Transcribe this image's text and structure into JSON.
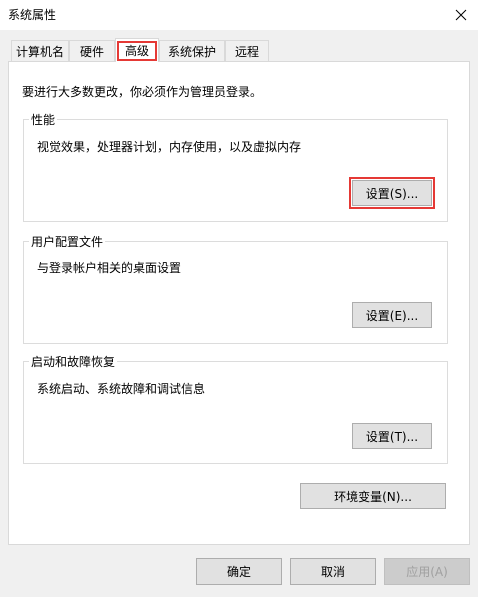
{
  "window": {
    "title": "系统属性"
  },
  "tabs": [
    {
      "label": "计算机名",
      "active": false
    },
    {
      "label": "硬件",
      "active": false
    },
    {
      "label": "高级",
      "active": true
    },
    {
      "label": "系统保护",
      "active": false
    },
    {
      "label": "远程",
      "active": false
    }
  ],
  "advanced": {
    "admin_note": "要进行大多数更改，你必须作为管理员登录。",
    "performance": {
      "title": "性能",
      "description": "视觉效果，处理器计划，内存使用，以及虚拟内存",
      "button": "设置(S)..."
    },
    "user_profiles": {
      "title": "用户配置文件",
      "description": "与登录帐户相关的桌面设置",
      "button": "设置(E)..."
    },
    "startup_recovery": {
      "title": "启动和故障恢复",
      "description": "系统启动、系统故障和调试信息",
      "button": "设置(T)..."
    },
    "env_button": "环境变量(N)..."
  },
  "footer": {
    "ok": "确定",
    "cancel": "取消",
    "apply": "应用(A)"
  },
  "colors": {
    "highlight": "#e53935"
  }
}
